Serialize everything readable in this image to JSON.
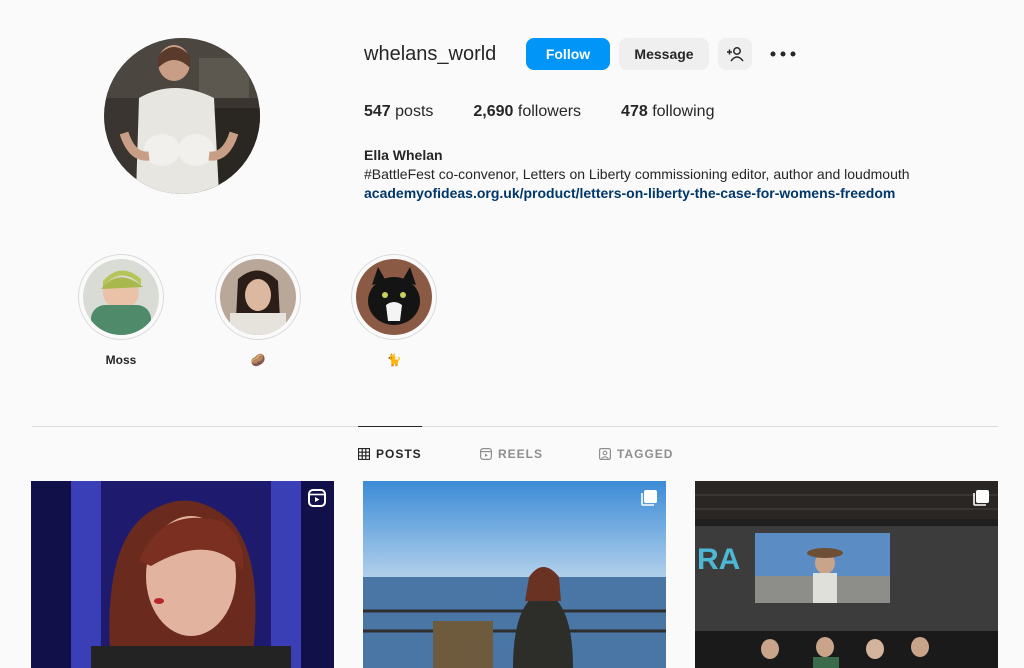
{
  "profile": {
    "username": "whelans_world",
    "follow_label": "Follow",
    "message_label": "Message",
    "stats": {
      "posts_count": "547",
      "posts_label": "posts",
      "followers_count": "2,690",
      "followers_label": "followers",
      "following_count": "478",
      "following_label": "following"
    },
    "bio": {
      "name": "Ella Whelan",
      "text": "#BattleFest co-convenor, Letters on Liberty commissioning editor, author and loudmouth",
      "link": "academyofideas.org.uk/product/letters-on-liberty-the-case-for-womens-freedom"
    }
  },
  "highlights": [
    {
      "label": "Moss"
    },
    {
      "label": "🥔"
    },
    {
      "label": "🐈"
    }
  ],
  "tabs": [
    {
      "label": "POSTS",
      "icon": "grid-icon",
      "active": true
    },
    {
      "label": "REELS",
      "icon": "reels-icon",
      "active": false
    },
    {
      "label": "TAGGED",
      "icon": "tagged-icon",
      "active": false
    }
  ],
  "posts": [
    {
      "type": "reel",
      "icon": "reel-icon"
    },
    {
      "type": "carousel",
      "icon": "carousel-icon"
    },
    {
      "type": "carousel",
      "icon": "carousel-icon"
    }
  ],
  "colors": {
    "accent": "#0095f6",
    "link": "#00376b",
    "background": "#fafafa"
  }
}
